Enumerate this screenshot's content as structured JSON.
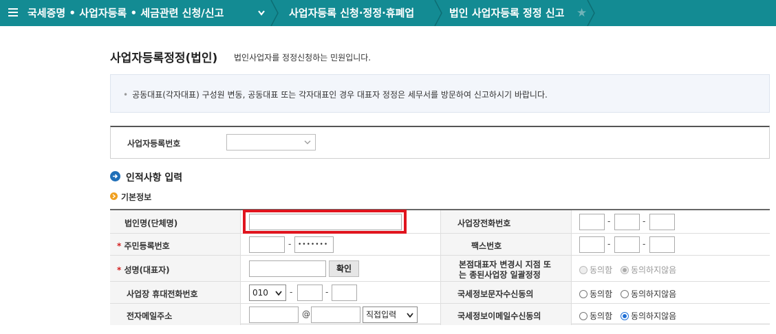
{
  "nav": {
    "breadcrumb1": "국세증명 • 사업자등록 • 세금관련 신청/신고",
    "breadcrumb2": "사업자등록 신청·정정·휴폐업",
    "breadcrumb3": "법인 사업자등록 정정 신고"
  },
  "header": {
    "title": "사업자등록정정(법인)",
    "subtitle": "법인사업자를 정정신청하는 민원입니다."
  },
  "notice": {
    "text": "공동대표(각자대표) 구성원 변동, 공동대표 또는 각자대표인 경우 대표자 정정은 세무서를 방문하여 신고하시기 바랍니다."
  },
  "regbox": {
    "label": "사업자등록번호",
    "selected": ""
  },
  "section": {
    "title": "인적사항 입력",
    "subtitle": "기본정보"
  },
  "form": {
    "corp_name_label": "법인명(단체명)",
    "corp_name_value": "",
    "phone_label": "사업장전화번호",
    "rrn_label": "주민등록번호",
    "rrn_back": "•••••••",
    "fax_label": "팩스번호",
    "rep_name_label": "성명(대표자)",
    "confirm_button": "확인",
    "branch_label_line1": "본점대표자 변경시 지점 또",
    "branch_label_line2": "는 종된사업장 일괄정정",
    "mobile_label": "사업장 휴대전화번호",
    "mobile_prefix": "010",
    "sms_label": "국세정보문자수신동의",
    "email_label": "전자메일주소",
    "email_at": "@",
    "email_domain_option": "직접입력",
    "email_consent_label": "국세정보이메일수신동의",
    "agree": "동의함",
    "disagree": "동의하지않음",
    "dash": "-"
  },
  "colors": {
    "nav_bg": "#138b93",
    "highlight": "#e0141e",
    "radio_selected": "#1f6fd6"
  }
}
